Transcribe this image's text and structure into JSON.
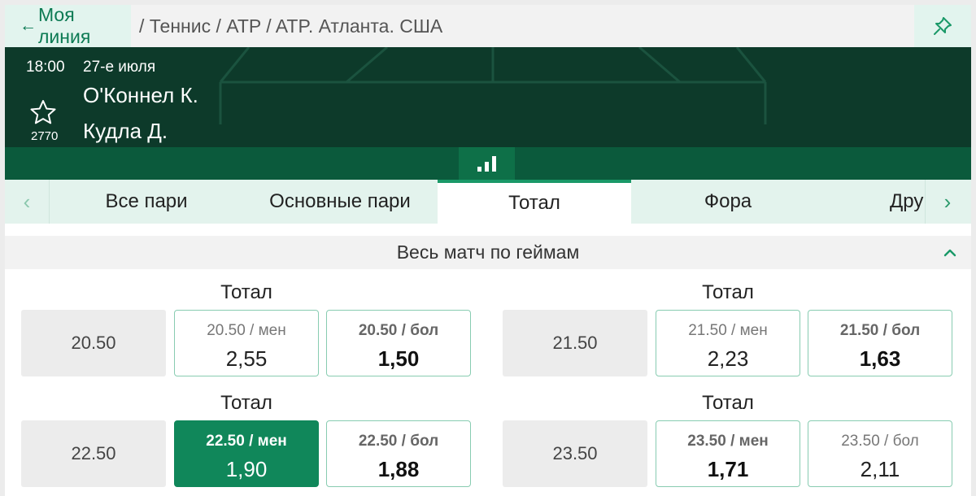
{
  "topbar": {
    "back_label": "Моя линия",
    "breadcrumb": "/ Теннис / ATP / ATP. Атланта. США"
  },
  "match": {
    "time": "18:00",
    "date": "27-е июля",
    "team1": "О'Коннел К.",
    "team2": "Кудла Д.",
    "favorites_count": "2770"
  },
  "tabs": {
    "items": [
      "Все пари",
      "Основные пари",
      "Тотал",
      "Фора",
      "Дру"
    ],
    "active": "Тотал"
  },
  "section": {
    "title": "Весь матч по геймам"
  },
  "markets": [
    {
      "title": "Тотал",
      "param": "20.50",
      "under": {
        "label": "20.50 / мен",
        "odd": "2,55",
        "bold": false,
        "selected": false
      },
      "over": {
        "label": "20.50 / бол",
        "odd": "1,50",
        "bold": true,
        "selected": false
      }
    },
    {
      "title": "Тотал",
      "param": "21.50",
      "under": {
        "label": "21.50 / мен",
        "odd": "2,23",
        "bold": false,
        "selected": false
      },
      "over": {
        "label": "21.50 / бол",
        "odd": "1,63",
        "bold": true,
        "selected": false
      }
    },
    {
      "title": "Тотал",
      "param": "22.50",
      "under": {
        "label": "22.50 / мен",
        "odd": "1,90",
        "bold": true,
        "selected": true
      },
      "over": {
        "label": "22.50 / бол",
        "odd": "1,88",
        "bold": true,
        "selected": false
      }
    },
    {
      "title": "Тотал",
      "param": "23.50",
      "under": {
        "label": "23.50 / мен",
        "odd": "1,71",
        "bold": true,
        "selected": false
      },
      "over": {
        "label": "23.50 / бол",
        "odd": "2,11",
        "bold": false,
        "selected": false
      }
    }
  ],
  "colors": {
    "accent": "#10875a",
    "header_bg": "#0d3a2a",
    "tab_bg": "#e3f3ed"
  }
}
